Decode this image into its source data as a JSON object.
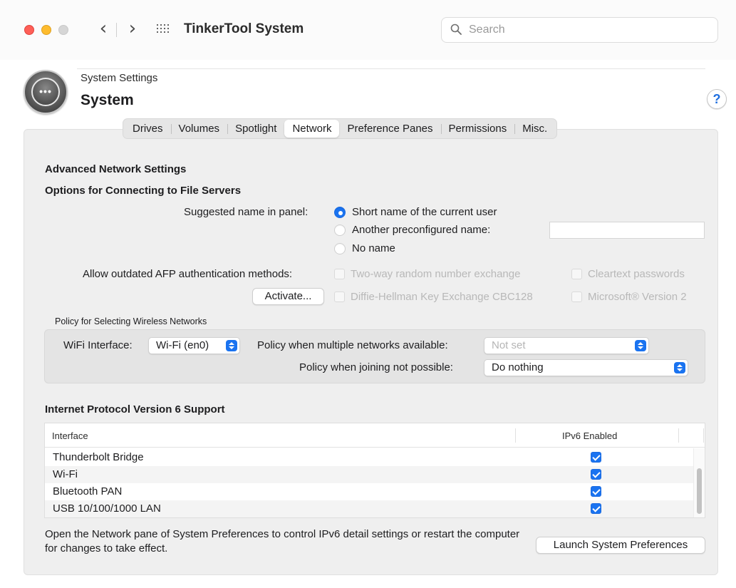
{
  "window": {
    "app_title": "TinkerTool System",
    "search_placeholder": "Search"
  },
  "header": {
    "breadcrumb": "System Settings",
    "title": "System",
    "help": "?"
  },
  "tabs": [
    {
      "label": "Drives",
      "active": false
    },
    {
      "label": "Volumes",
      "active": false
    },
    {
      "label": "Spotlight",
      "active": false
    },
    {
      "label": "Network",
      "active": true
    },
    {
      "label": "Preference Panes",
      "active": false
    },
    {
      "label": "Permissions",
      "active": false
    },
    {
      "label": "Misc.",
      "active": false
    }
  ],
  "advanced": {
    "heading": "Advanced Network Settings",
    "file_servers_heading": "Options for Connecting to File Servers",
    "suggested_name_label": "Suggested name in panel:",
    "radio_options": [
      {
        "label": "Short name of the current user",
        "selected": true
      },
      {
        "label": "Another preconfigured name:",
        "selected": false
      },
      {
        "label": "No name",
        "selected": false
      }
    ],
    "preconfigured_name_value": "",
    "afp_label": "Allow outdated AFP authentication methods:",
    "activate_button": "Activate...",
    "afp_methods": [
      {
        "label": "Two-way random number exchange",
        "checked": false,
        "enabled": false
      },
      {
        "label": "Cleartext passwords",
        "checked": false,
        "enabled": false
      },
      {
        "label": "Diffie-Hellman Key Exchange CBC128",
        "checked": false,
        "enabled": false
      },
      {
        "label": "Microsoft® Version 2",
        "checked": false,
        "enabled": false
      }
    ]
  },
  "wireless": {
    "heading": "Policy for Selecting Wireless Networks",
    "wifi_interface_label": "WiFi Interface:",
    "wifi_interface_value": "Wi-Fi (en0)",
    "multiple_label": "Policy when multiple networks available:",
    "multiple_value": "Not set",
    "joining_label": "Policy when joining not possible:",
    "joining_value": "Do nothing"
  },
  "ipv6": {
    "heading": "Internet Protocol Version 6 Support",
    "columns": [
      "Interface",
      "IPv6 Enabled"
    ],
    "rows": [
      {
        "interface": "Thunderbolt Bridge",
        "enabled": true
      },
      {
        "interface": "Wi-Fi",
        "enabled": true
      },
      {
        "interface": "Bluetooth PAN",
        "enabled": true
      },
      {
        "interface": "USB 10/100/1000 LAN",
        "enabled": true
      }
    ],
    "note": "Open the Network pane of System Preferences to control IPv6 detail settings or restart the computer for changes to take effect.",
    "launch_button": "Launch System Preferences"
  },
  "colors": {
    "accent": "#1a73f0",
    "close": "#fe5f57",
    "minimize": "#febc2e"
  }
}
